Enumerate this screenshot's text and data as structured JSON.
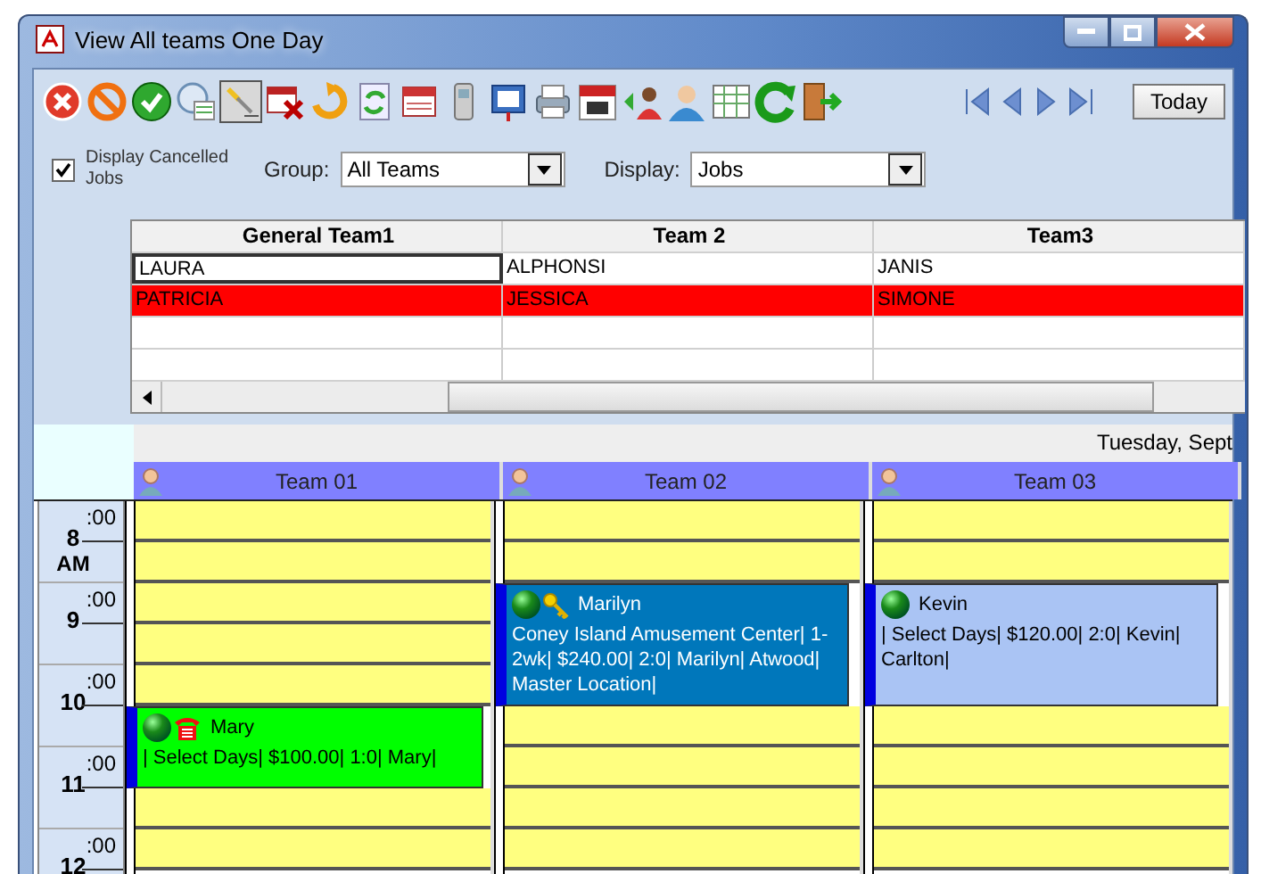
{
  "window": {
    "title": "View All teams One Day"
  },
  "toolbar": {
    "today_button": "Today"
  },
  "options": {
    "cancelled": {
      "label": "Display Cancelled Jobs",
      "checked": true
    },
    "group": {
      "label": "Group:",
      "value": "All Teams"
    },
    "display": {
      "label": "Display:",
      "value": "Jobs"
    }
  },
  "team_grid": {
    "columns": [
      "General Team1",
      "Team 2",
      "Team3"
    ],
    "rows": [
      {
        "cells": [
          "LAURA",
          "ALPHONSI",
          "JANIS"
        ],
        "color": "#ffffff",
        "selected": true
      },
      {
        "cells": [
          "PATRICIA",
          "JESSICA",
          "SIMONE"
        ],
        "color": "#ff0000",
        "selected": false
      }
    ]
  },
  "schedule": {
    "date": "Tuesday, Sept",
    "hours": [
      {
        "hour": "8",
        "minutes": ":00",
        "suffix": "AM"
      },
      {
        "hour": "9",
        "minutes": ":00"
      },
      {
        "hour": "10",
        "minutes": ":00"
      },
      {
        "hour": "11",
        "minutes": ":00"
      },
      {
        "hour": "12",
        "minutes": ":00"
      }
    ],
    "teams": [
      {
        "name": "Team 01",
        "slots": [
          {
            "booked": false
          },
          {
            "booked": false
          },
          {
            "booked": false
          },
          {
            "booked": false
          },
          {
            "booked": false
          },
          {
            "booked": true
          },
          {
            "booked": true
          },
          {
            "booked": false
          },
          {
            "booked": false
          }
        ],
        "appointments": [
          {
            "kind": "phone",
            "name": "Mary",
            "details": "| Select Days| $100.00| 1:0| Mary|",
            "color": "#00ff00"
          }
        ]
      },
      {
        "name": "Team 02",
        "slots": [
          {
            "booked": false
          },
          {
            "booked": false
          },
          {
            "booked": true
          },
          {
            "booked": true
          },
          {
            "booked": true
          },
          {
            "booked": false
          },
          {
            "booked": false
          },
          {
            "booked": false
          },
          {
            "booked": false
          }
        ],
        "appointments": [
          {
            "kind": "key",
            "name": "Marilyn",
            "details": "Coney Island Amusement Center| 1-2wk| $240.00| 2:0| Marilyn| Atwood| Master Location|",
            "color": "#0077bb"
          }
        ]
      },
      {
        "name": "Team 03",
        "slots": [
          {
            "booked": false
          },
          {
            "booked": false
          },
          {
            "booked": true
          },
          {
            "booked": true
          },
          {
            "booked": true
          },
          {
            "booked": false
          },
          {
            "booked": false
          },
          {
            "booked": false
          },
          {
            "booked": false
          }
        ],
        "appointments": [
          {
            "kind": "plain",
            "name": "Kevin",
            "details": "| Select Days| $120.00| 2:0| Kevin| Carlton|",
            "color": "#aac4f4"
          }
        ]
      }
    ]
  }
}
